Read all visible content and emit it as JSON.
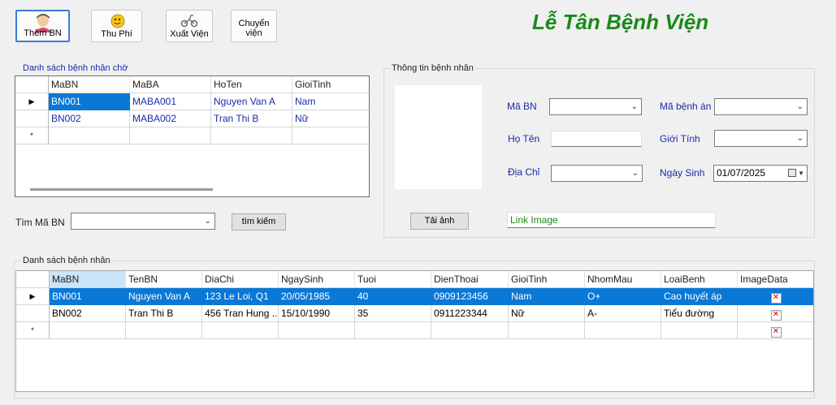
{
  "toolbar": {
    "buttons": [
      {
        "label": "Thêm BN"
      },
      {
        "label": "Thu Phí"
      },
      {
        "label": "Xuất Viện"
      },
      {
        "label": "Chuyển viện"
      }
    ]
  },
  "app_title": "Lễ Tân Bệnh Viện",
  "waiting": {
    "title": "Danh sách bệnh nhân chờ",
    "columns": [
      "MaBN",
      "MaBA",
      "HoTen",
      "GioiTinh"
    ],
    "rows": [
      [
        "BN001",
        "MABA001",
        "Nguyen Van A",
        "Nam"
      ],
      [
        "BN002",
        "MABA002",
        "Tran Thi B",
        "Nữ"
      ]
    ],
    "new_row_marker": "*",
    "current_row_marker": "▶"
  },
  "search": {
    "label": "Tìm Mã BN",
    "value": "",
    "button": "tìm kiếm"
  },
  "info": {
    "title": "Thông tin bệnh nhân",
    "upload_button": "Tải ảnh",
    "link_image": "Link Image",
    "fields": {
      "ma_bn": {
        "label": "Mã BN",
        "value": ""
      },
      "ma_benh_an": {
        "label": "Mã bệnh án",
        "value": ""
      },
      "ho_ten": {
        "label": "Họ Tên",
        "value": ""
      },
      "gioi_tinh": {
        "label": "Giới Tính",
        "value": ""
      },
      "dia_chi": {
        "label": "Địa Chỉ",
        "value": ""
      },
      "ngay_sinh": {
        "label": "Ngày Sinh",
        "value": "01/07/2025"
      }
    }
  },
  "patients": {
    "title": "Danh sách bệnh nhân",
    "columns": [
      "MaBN",
      "TenBN",
      "DiaChi",
      "NgaySinh",
      "Tuoi",
      "DienThoai",
      "GioiTinh",
      "NhomMau",
      "LoaiBenh",
      "ImageData"
    ],
    "rows": [
      [
        "BN001",
        "Nguyen Van A",
        "123 Le Loi, Q1",
        "20/05/1985",
        "40",
        "0909123456",
        "Nam",
        "O+",
        "Cao huyết áp",
        "✕"
      ],
      [
        "BN002",
        "Tran Thi B",
        "456 Tran Hung ...",
        "15/10/1990",
        "35",
        "0911223344",
        "Nữ",
        "A-",
        "Tiểu đường",
        "✕"
      ]
    ],
    "new_row_image": "✕"
  }
}
